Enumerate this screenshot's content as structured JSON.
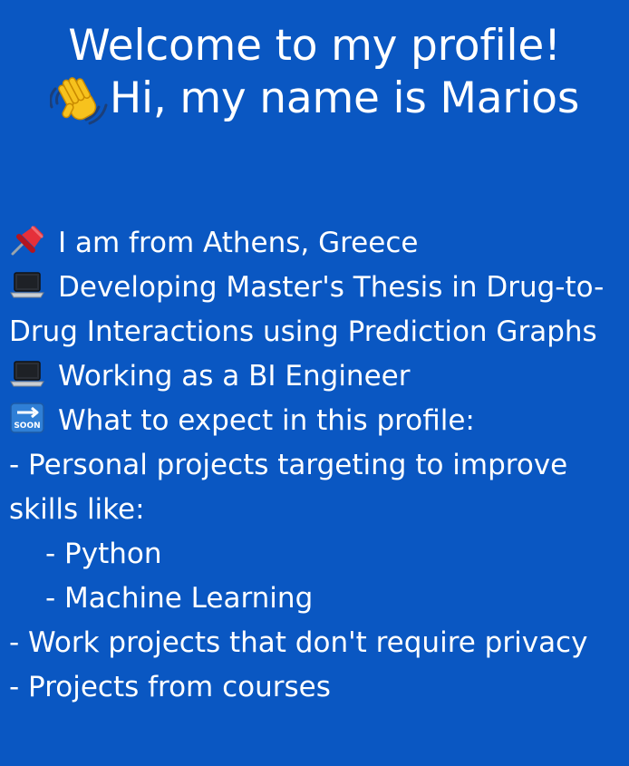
{
  "header": {
    "welcome": "Welcome to my profile!",
    "greeting": "Hi, my name is Marios",
    "greeting_icon": "waving-hand-icon"
  },
  "intro": {
    "location": {
      "icon": "pushpin-icon",
      "text": "I am from Athens, Greece"
    },
    "thesis": {
      "icon": "laptop-icon",
      "text": "Developing Master's Thesis in Drug-to-Drug Interactions using Prediction Graphs"
    },
    "job": {
      "icon": "laptop-icon",
      "text": "Working as a BI Engineer"
    },
    "expect": {
      "icon": "soon-arrow-icon",
      "text": "What to expect in this profile:"
    }
  },
  "list": {
    "personal": "- Personal projects targeting to improve skills like:",
    "python": "- Python",
    "ml": "- Machine Learning",
    "work": "- Work projects that don't require privacy",
    "courses": "- Projects from courses"
  },
  "colors": {
    "background": "#0a57c2",
    "text": "#ffffff"
  }
}
